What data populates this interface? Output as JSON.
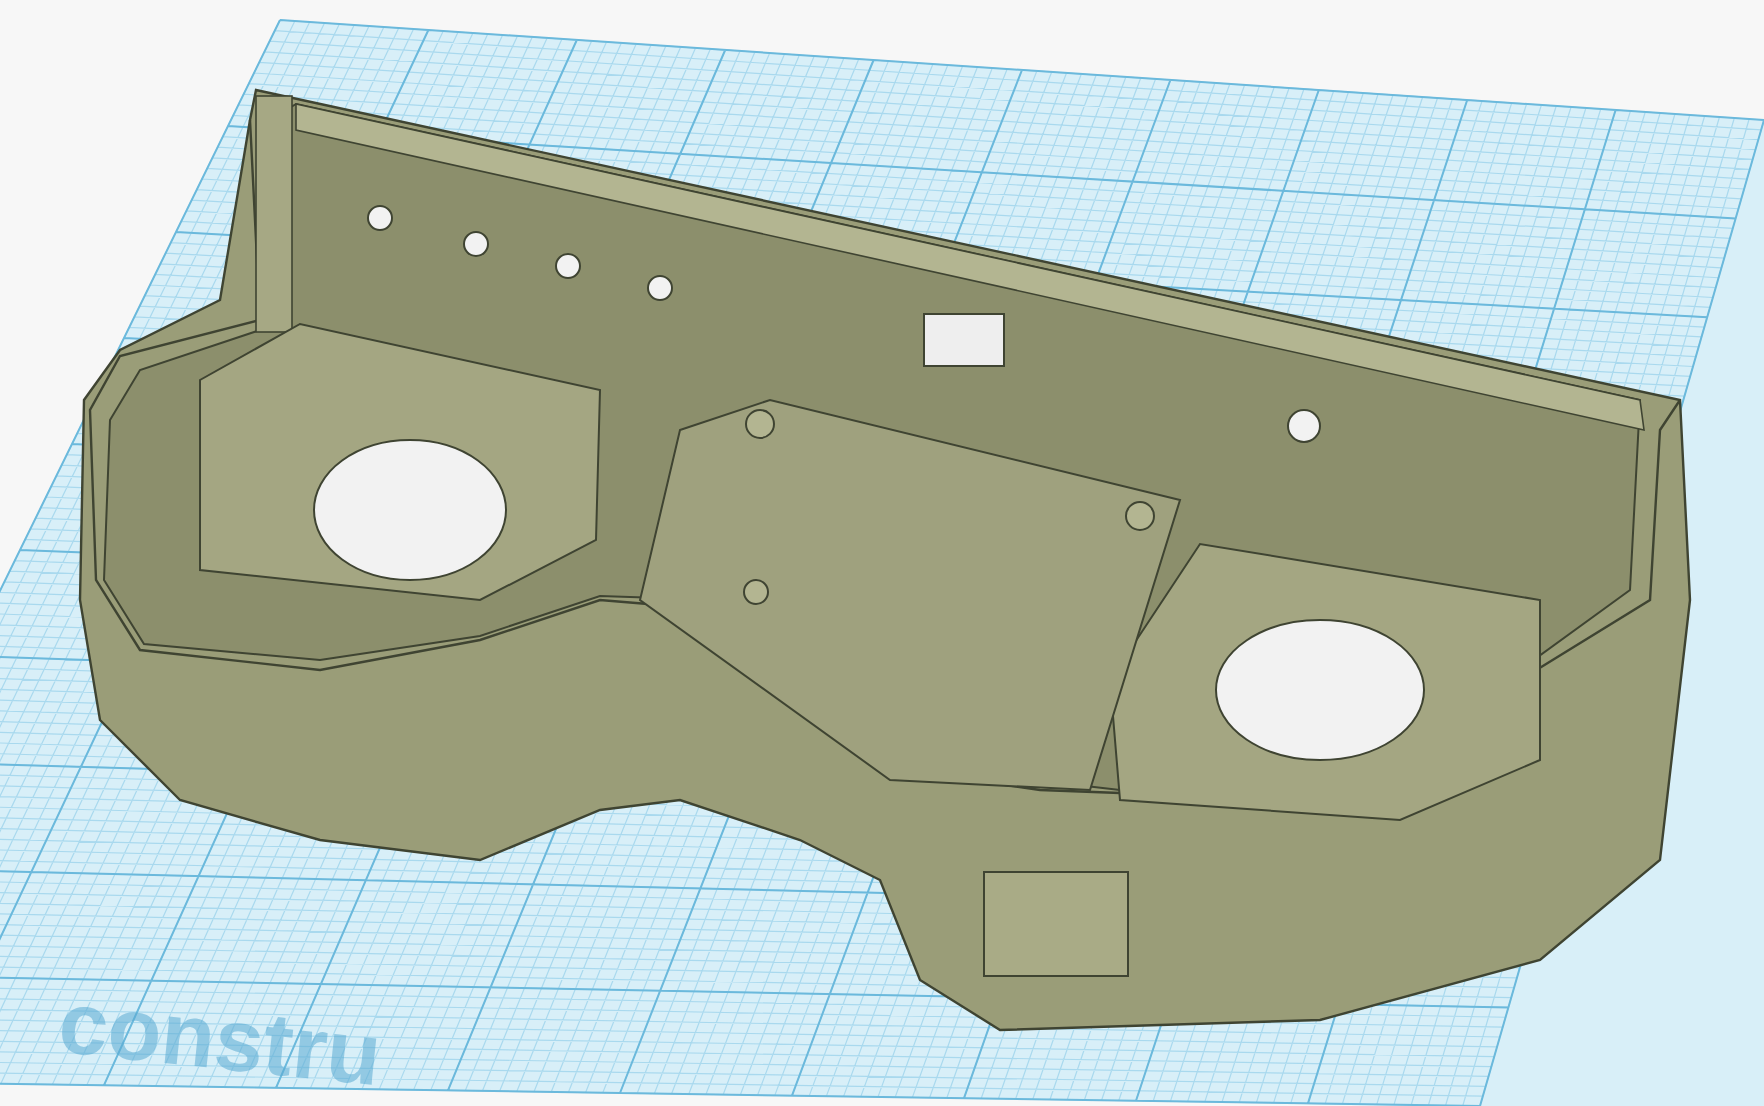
{
  "workplane": {
    "label": "constru"
  }
}
